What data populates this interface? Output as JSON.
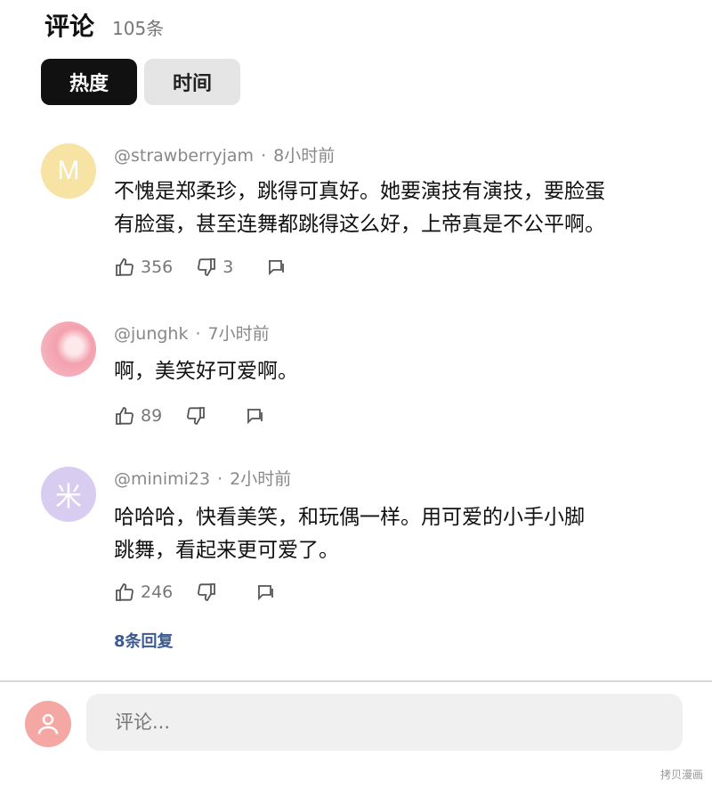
{
  "header": {
    "title": "评论",
    "count": "105条"
  },
  "tabs": [
    {
      "label": "热度",
      "active": true
    },
    {
      "label": "时间",
      "active": false
    }
  ],
  "comments": [
    {
      "avatar_letter": "M",
      "avatar_color": "#f7e3a3",
      "username": "@strawberryjam",
      "time": "8小时前",
      "lines": [
        "不愧是郑柔珍，跳得可真好。她要演技有演技，要脸蛋",
        "有脸蛋，甚至连舞都跳得这么好，上帝真是不公平啊。"
      ],
      "likes": "356",
      "dislikes": "3"
    },
    {
      "avatar_letter": "",
      "avatar_color": "#f6b3bd",
      "username": "@junghk",
      "time": "7小时前",
      "lines": [
        "啊，美笑好可爱啊。"
      ],
      "likes": "89",
      "dislikes": ""
    },
    {
      "avatar_letter": "米",
      "avatar_color": "#d8cdf0",
      "username": "@minimi23",
      "time": "2小时前",
      "lines": [
        "哈哈哈，快看美笑，和玩偶一样。用可爱的小手小脚",
        "跳舞，看起来更可爱了。"
      ],
      "likes": "246",
      "dislikes": "",
      "replies": "8条回复"
    }
  ],
  "composer": {
    "placeholder": "评论..."
  },
  "watermark": "拷贝漫画",
  "icons": {
    "like": "thumbs-up-icon",
    "dislike": "thumbs-down-icon",
    "reply": "reply-icon",
    "user": "user-icon"
  }
}
